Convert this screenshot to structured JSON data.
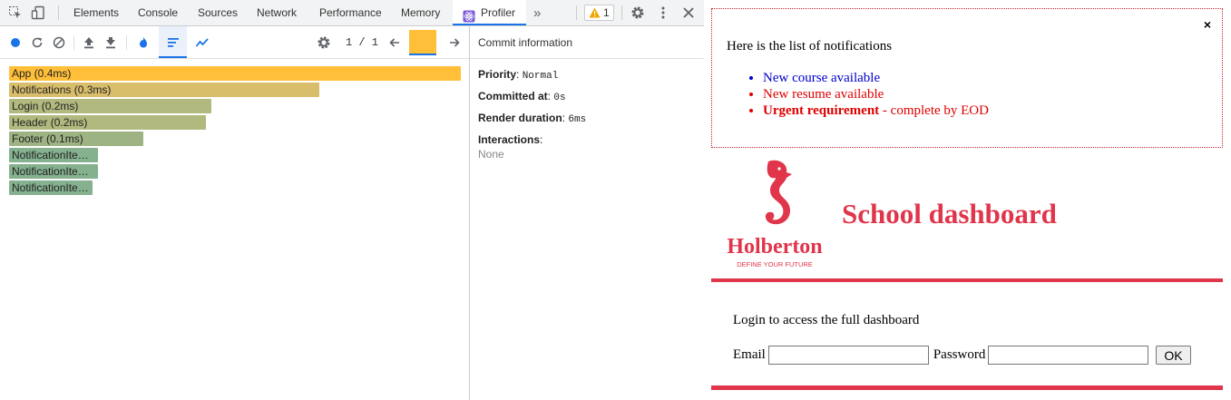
{
  "devtools": {
    "tabs": [
      {
        "label": "Elements"
      },
      {
        "label": "Console"
      },
      {
        "label": "Sources"
      },
      {
        "label": "Network"
      },
      {
        "label": "Performance"
      },
      {
        "label": "Memory"
      },
      {
        "label": "Profiler",
        "active": true
      }
    ],
    "more_tabs_glyph": "»",
    "warning_count": "1",
    "icons": [
      "inspect-icon",
      "device-toggle-icon",
      "react-icon",
      "warning-icon",
      "settings-gear-icon",
      "kebab-menu-icon",
      "close-icon"
    ]
  },
  "profiler": {
    "toolbar_icons": [
      "record-icon",
      "reload-icon",
      "clear-icon",
      "upload-icon",
      "download-icon",
      "flamegraph-icon",
      "ranked-icon",
      "timeline-icon",
      "settings-icon",
      "prev-icon",
      "next-icon"
    ],
    "commit_counter": "1 / 1",
    "commit_bar_color": "#ffbf39",
    "bars": [
      {
        "label": "App (0.4ms)",
        "color": "#ffbf39"
      },
      {
        "label": "Notifications (0.3ms)",
        "color": "#d8bd6b"
      },
      {
        "label": "Login (0.2ms)",
        "color": "#b1b97e"
      },
      {
        "label": "Header (0.2ms)",
        "color": "#b1b97e"
      },
      {
        "label": "Footer (0.1ms)",
        "color": "#9eb383"
      },
      {
        "label": "NotificationIte…",
        "color": "#85b18f"
      },
      {
        "label": "NotificationIte…",
        "color": "#85b18f"
      },
      {
        "label": "NotificationIte…",
        "color": "#85b18f"
      }
    ]
  },
  "commit_info": {
    "header": "Commit information",
    "priority_label": "Priority",
    "priority_value": "Normal",
    "committed_label": "Committed at",
    "committed_value": "0s",
    "render_label": "Render duration",
    "render_value": "6ms",
    "interactions_label": "Interactions",
    "interactions_value": "None"
  },
  "page": {
    "notifications": {
      "close": "×",
      "title": "Here is the list of notifications",
      "items": [
        {
          "text": "New course available",
          "color": "#0000cc"
        },
        {
          "text": "New resume available",
          "color": "#e00000"
        },
        {
          "bold": "Urgent requirement",
          "rest": " - complete by EOD",
          "color": "#e00000"
        }
      ]
    },
    "logo": {
      "wordmark": "Holberton",
      "tagline": "DEFINE YOUR FUTURE"
    },
    "title": "School dashboard",
    "login_text": "Login to access the full dashboard",
    "email_label": "Email",
    "password_label": "Password",
    "ok_label": "OK",
    "brand_color": "#e0354b"
  }
}
